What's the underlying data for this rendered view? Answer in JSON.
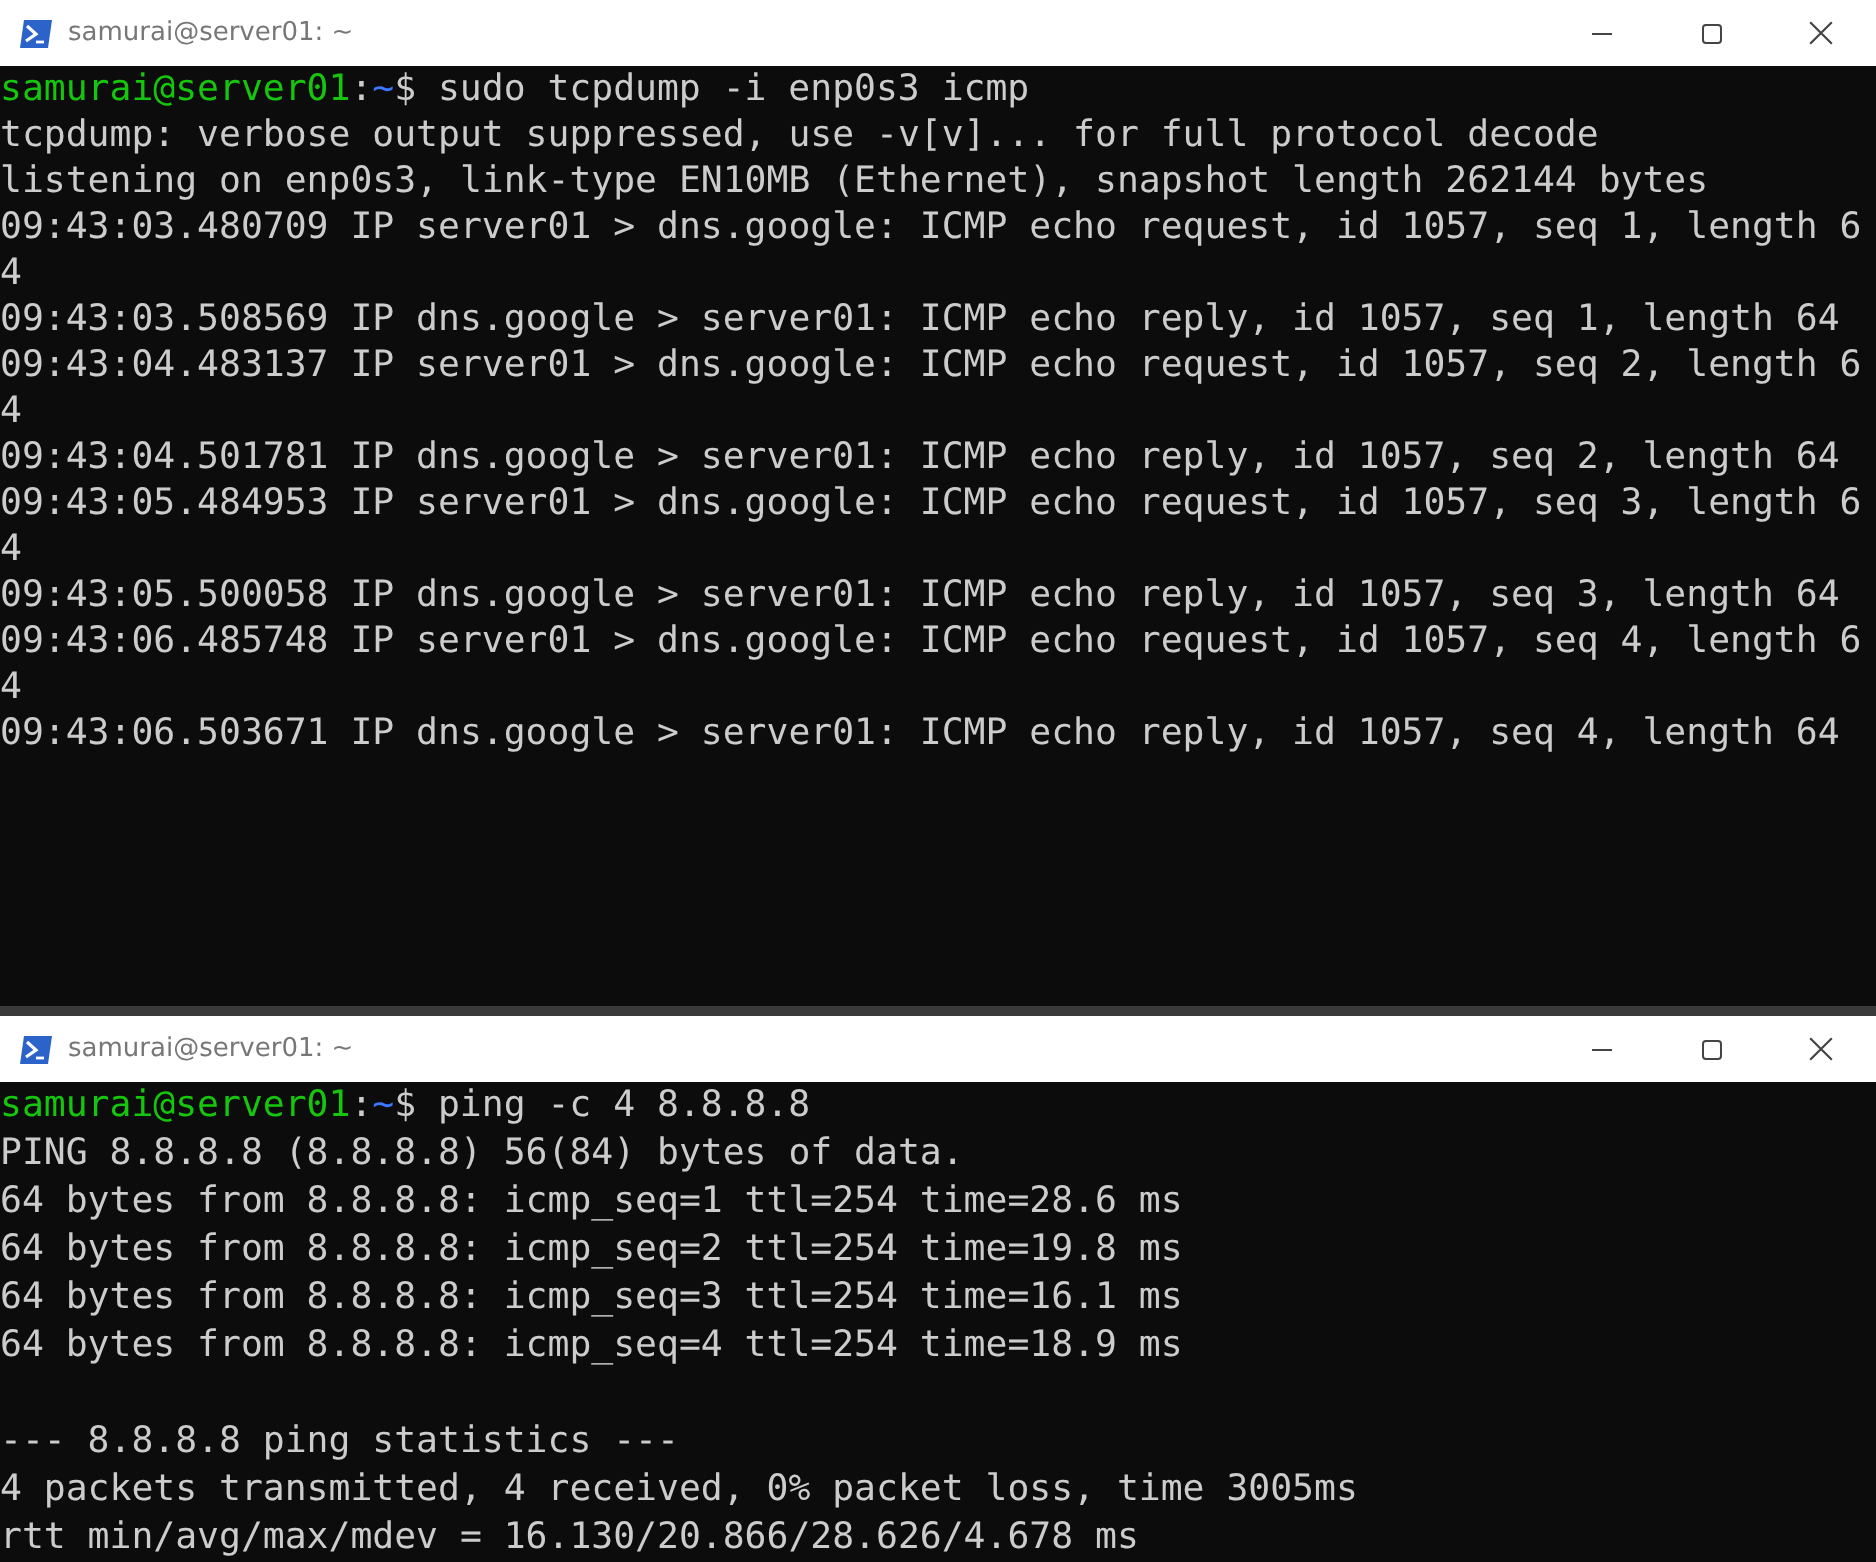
{
  "windows": [
    {
      "title": "samurai@server01: ~",
      "lines": [
        {
          "kind": "prompt",
          "user_host": "samurai@server01",
          "separator": ":",
          "path": "~",
          "symbol": "$",
          "command": "sudo tcpdump -i enp0s3 icmp"
        },
        {
          "kind": "output",
          "text": "tcpdump: verbose output suppressed, use -v[v]... for full protocol decode"
        },
        {
          "kind": "output",
          "text": "listening on enp0s3, link-type EN10MB (Ethernet), snapshot length 262144 bytes"
        },
        {
          "kind": "output",
          "text": "09:43:03.480709 IP server01 > dns.google: ICMP echo request, id 1057, seq 1, length 6"
        },
        {
          "kind": "output",
          "text": "4"
        },
        {
          "kind": "output",
          "text": "09:43:03.508569 IP dns.google > server01: ICMP echo reply, id 1057, seq 1, length 64"
        },
        {
          "kind": "output",
          "text": "09:43:04.483137 IP server01 > dns.google: ICMP echo request, id 1057, seq 2, length 6"
        },
        {
          "kind": "output",
          "text": "4"
        },
        {
          "kind": "output",
          "text": "09:43:04.501781 IP dns.google > server01: ICMP echo reply, id 1057, seq 2, length 64"
        },
        {
          "kind": "output",
          "text": "09:43:05.484953 IP server01 > dns.google: ICMP echo request, id 1057, seq 3, length 6"
        },
        {
          "kind": "output",
          "text": "4"
        },
        {
          "kind": "output",
          "text": "09:43:05.500058 IP dns.google > server01: ICMP echo reply, id 1057, seq 3, length 64"
        },
        {
          "kind": "output",
          "text": "09:43:06.485748 IP server01 > dns.google: ICMP echo request, id 1057, seq 4, length 6"
        },
        {
          "kind": "output",
          "text": "4"
        },
        {
          "kind": "output",
          "text": "09:43:06.503671 IP dns.google > server01: ICMP echo reply, id 1057, seq 4, length 64"
        }
      ]
    },
    {
      "title": "samurai@server01: ~",
      "lines": [
        {
          "kind": "prompt",
          "user_host": "samurai@server01",
          "separator": ":",
          "path": "~",
          "symbol": "$",
          "command": "ping -c 4 8.8.8.8"
        },
        {
          "kind": "output",
          "text": "PING 8.8.8.8 (8.8.8.8) 56(84) bytes of data."
        },
        {
          "kind": "output",
          "text": "64 bytes from 8.8.8.8: icmp_seq=1 ttl=254 time=28.6 ms"
        },
        {
          "kind": "output",
          "text": "64 bytes from 8.8.8.8: icmp_seq=2 ttl=254 time=19.8 ms"
        },
        {
          "kind": "output",
          "text": "64 bytes from 8.8.8.8: icmp_seq=3 ttl=254 time=16.1 ms"
        },
        {
          "kind": "output",
          "text": "64 bytes from 8.8.8.8: icmp_seq=4 ttl=254 time=18.9 ms"
        },
        {
          "kind": "blank"
        },
        {
          "kind": "output",
          "text": "--- 8.8.8.8 ping statistics ---"
        },
        {
          "kind": "output",
          "text": "4 packets transmitted, 4 received, 0% packet loss, time 3005ms"
        },
        {
          "kind": "output",
          "text": "rtt min/avg/max/mdev = 16.130/20.866/28.626/4.678 ms"
        }
      ]
    }
  ]
}
